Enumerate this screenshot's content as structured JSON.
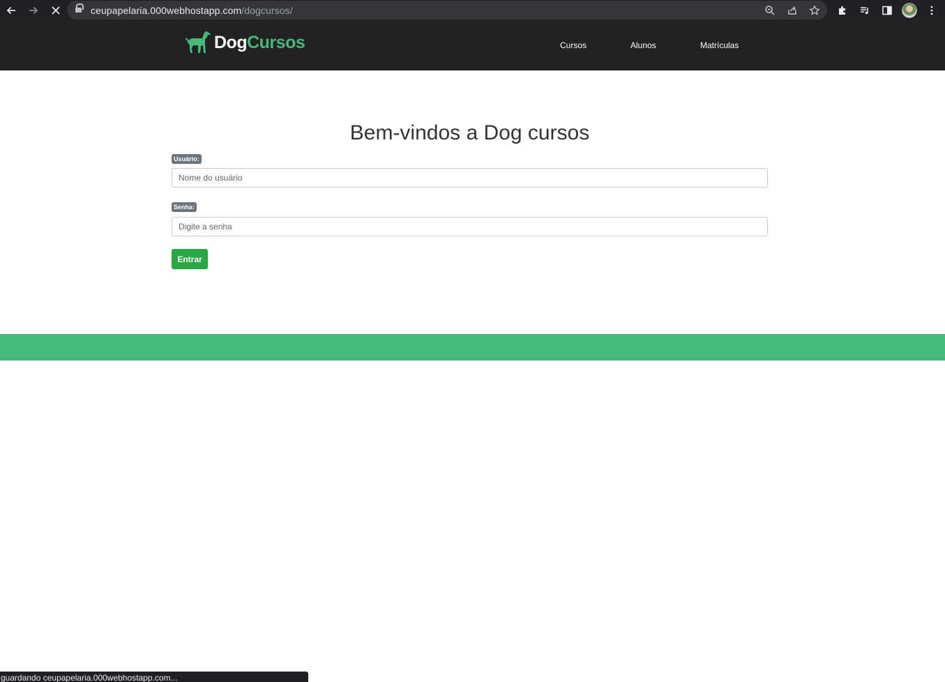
{
  "browser": {
    "url_host": "ceupapelaria.000webhostapp.com",
    "url_path": "/dogcursos/",
    "status_text": "guardando ceupapelaria.000webhostapp.com..."
  },
  "header": {
    "logo_part1": "Dog",
    "logo_part2": "Cursos",
    "nav": [
      {
        "label": "Cursos"
      },
      {
        "label": "Alunos"
      },
      {
        "label": "Matrículas"
      }
    ]
  },
  "login": {
    "title": "Bem-vindos a Dog cursos",
    "user_label": "Usuário:",
    "user_placeholder": "Nome do usuário",
    "password_label": "Senha:",
    "password_placeholder": "Digite a senha",
    "submit_label": "Entrar"
  },
  "colors": {
    "brand_green": "#45b97c",
    "button_green": "#28a745",
    "header_dark": "#222222",
    "label_gray": "#6c757d"
  },
  "icons": {
    "back": "arrow-left-icon",
    "forward": "arrow-right-icon",
    "stop": "close-icon",
    "lock": "lock-icon",
    "zoom": "zoom-icon",
    "share": "share-icon",
    "bookmark": "star-icon",
    "extensions": "puzzle-icon",
    "media": "media-control-icon",
    "side_panel": "side-panel-icon",
    "menu": "more-vertical-icon",
    "logo": "dog-icon"
  }
}
